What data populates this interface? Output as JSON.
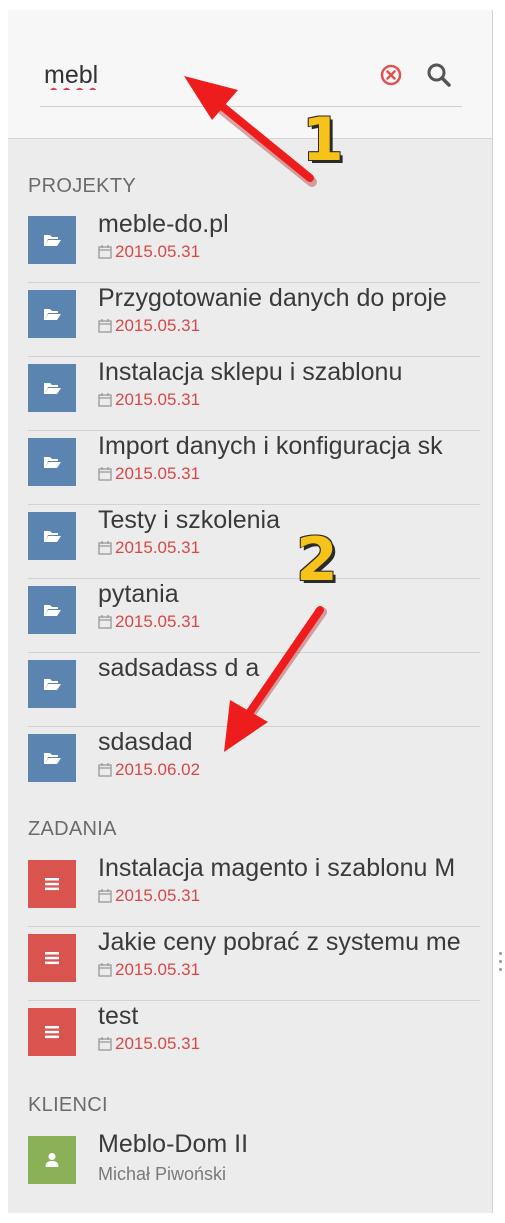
{
  "search": {
    "value": "mebl"
  },
  "colors": {
    "project_tile": "#5b84b1",
    "task_tile": "#d9534f",
    "client_tile": "#8bb158",
    "date": "#d94848",
    "annotation": "#f7c21a"
  },
  "icons": {
    "clear": "clear-circle-icon",
    "search": "search-icon",
    "project": "folder-open-icon",
    "task": "list-icon",
    "client": "user-icon",
    "date": "calendar-icon"
  },
  "sections": {
    "projects": {
      "title": "PROJEKTY",
      "items": [
        {
          "title": "meble-do.pl",
          "date": "2015.05.31"
        },
        {
          "title": "Przygotowanie danych do proje",
          "date": "2015.05.31"
        },
        {
          "title": "Instalacja sklepu i szablonu",
          "date": "2015.05.31"
        },
        {
          "title": "Import danych i konfiguracja sk",
          "date": "2015.05.31"
        },
        {
          "title": "Testy i szkolenia",
          "date": "2015.05.31"
        },
        {
          "title": "pytania",
          "date": "2015.05.31"
        },
        {
          "title": "sadsadass d a",
          "date": ""
        },
        {
          "title": "sdasdad",
          "date": "2015.06.02"
        }
      ]
    },
    "tasks": {
      "title": "ZADANIA",
      "items": [
        {
          "title": "Instalacja magento i szablonu M",
          "date": "2015.05.31"
        },
        {
          "title": "Jakie ceny pobrać z systemu me",
          "date": "2015.05.31"
        },
        {
          "title": "test",
          "date": "2015.05.31"
        }
      ]
    },
    "clients": {
      "title": "KLIENCI",
      "items": [
        {
          "title": "Meblo-Dom II",
          "subtitle": "Michał Piwoński"
        }
      ]
    }
  },
  "annotations": {
    "one": "1",
    "two": "2"
  }
}
